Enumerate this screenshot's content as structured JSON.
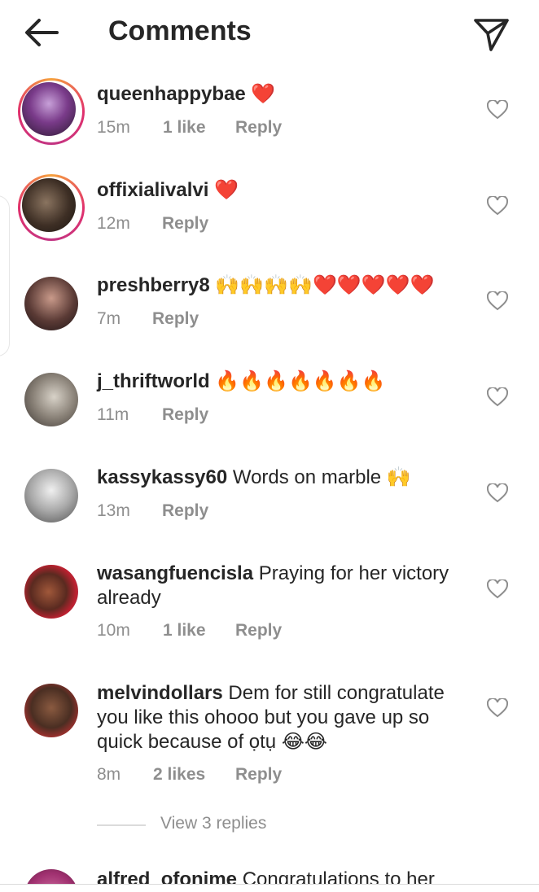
{
  "header": {
    "title": "Comments",
    "back_icon": "arrow-left-icon",
    "share_icon": "paper-plane-icon"
  },
  "comments": [
    {
      "username": "queenhappybae",
      "text": "❤️",
      "time": "15m",
      "likes": "1 like",
      "reply": "Reply"
    },
    {
      "username": "offixialivalvi",
      "text": "❤️",
      "time": "12m",
      "likes": "",
      "reply": "Reply"
    },
    {
      "username": "preshberry8",
      "text": "🙌🙌🙌🙌❤️❤️❤️❤️❤️",
      "time": "7m",
      "likes": "",
      "reply": "Reply"
    },
    {
      "username": "j_thriftworld",
      "text": "🔥🔥🔥🔥🔥🔥🔥",
      "time": "11m",
      "likes": "",
      "reply": "Reply"
    },
    {
      "username": "kassykassy60",
      "text": "Words on marble 🙌",
      "time": "13m",
      "likes": "",
      "reply": "Reply"
    },
    {
      "username": "wasangfuencisla",
      "text": "Praying for her victory already",
      "time": "10m",
      "likes": "1 like",
      "reply": "Reply"
    },
    {
      "username": "melvindollars",
      "text": "Dem for still congratulate you like this ohooo but  you gave up so quick because of ọtụ 😂😂",
      "time": "8m",
      "likes": "2 likes",
      "reply": "Reply"
    },
    {
      "username": "alfred_ofonime",
      "text": "Congratulations to her",
      "time": "",
      "likes": "",
      "reply": ""
    }
  ],
  "view_replies": "View 3 replies",
  "colors": {
    "text": "#262626",
    "muted": "#8e8e8e",
    "ring_start": "#f6a23d",
    "ring_end": "#c13584"
  }
}
